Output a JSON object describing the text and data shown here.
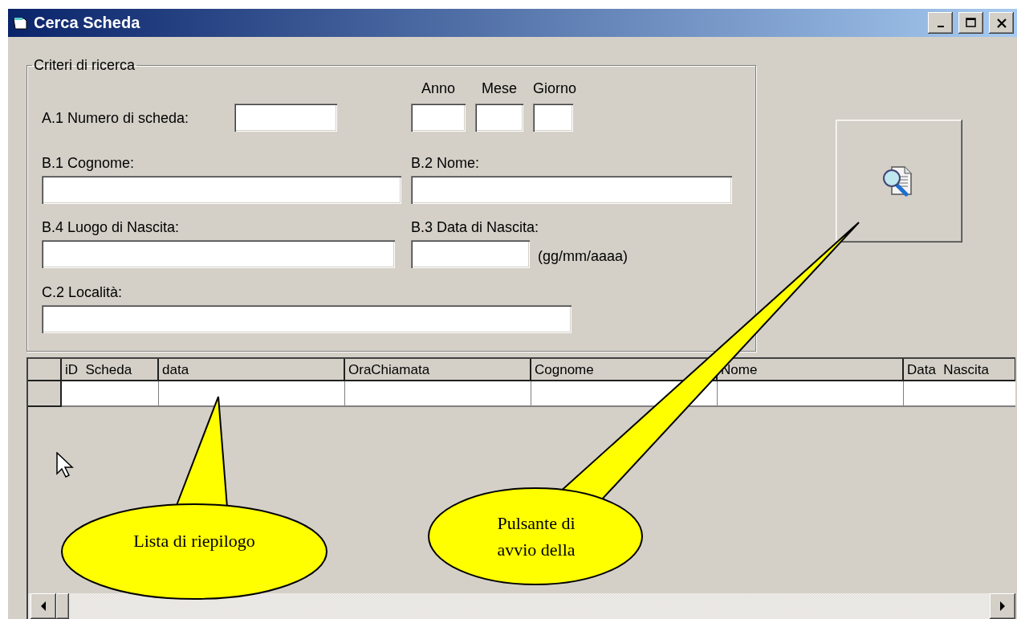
{
  "window": {
    "title": "Cerca Scheda"
  },
  "search_criteria": {
    "title": "Criteri di ricerca",
    "record_number": {
      "label": "A.1 Numero di scheda:"
    },
    "date_parts": [
      {
        "label": "Anno"
      },
      {
        "label": "Mese"
      },
      {
        "label": "Giorno"
      }
    ],
    "surname": {
      "label": "B.1 Cognome:"
    },
    "name": {
      "label": "B.2 Nome:"
    },
    "birthplace": {
      "label": "B.4 Luogo di Nascita:"
    },
    "birth_date": {
      "label": "B.3 Data di Nascita:",
      "hint": "(gg/mm/aaaa)"
    },
    "locality": {
      "label": "C.2 Località:"
    }
  },
  "grid": {
    "columns": [
      "iD  Scheda",
      "data",
      "OraChiamata",
      "Cognome",
      "Nome",
      "Data  Nascita"
    ]
  },
  "callouts": [
    {
      "text": "Lista di riepilogo"
    },
    {
      "text": "Pulsante di avvio della"
    }
  ]
}
